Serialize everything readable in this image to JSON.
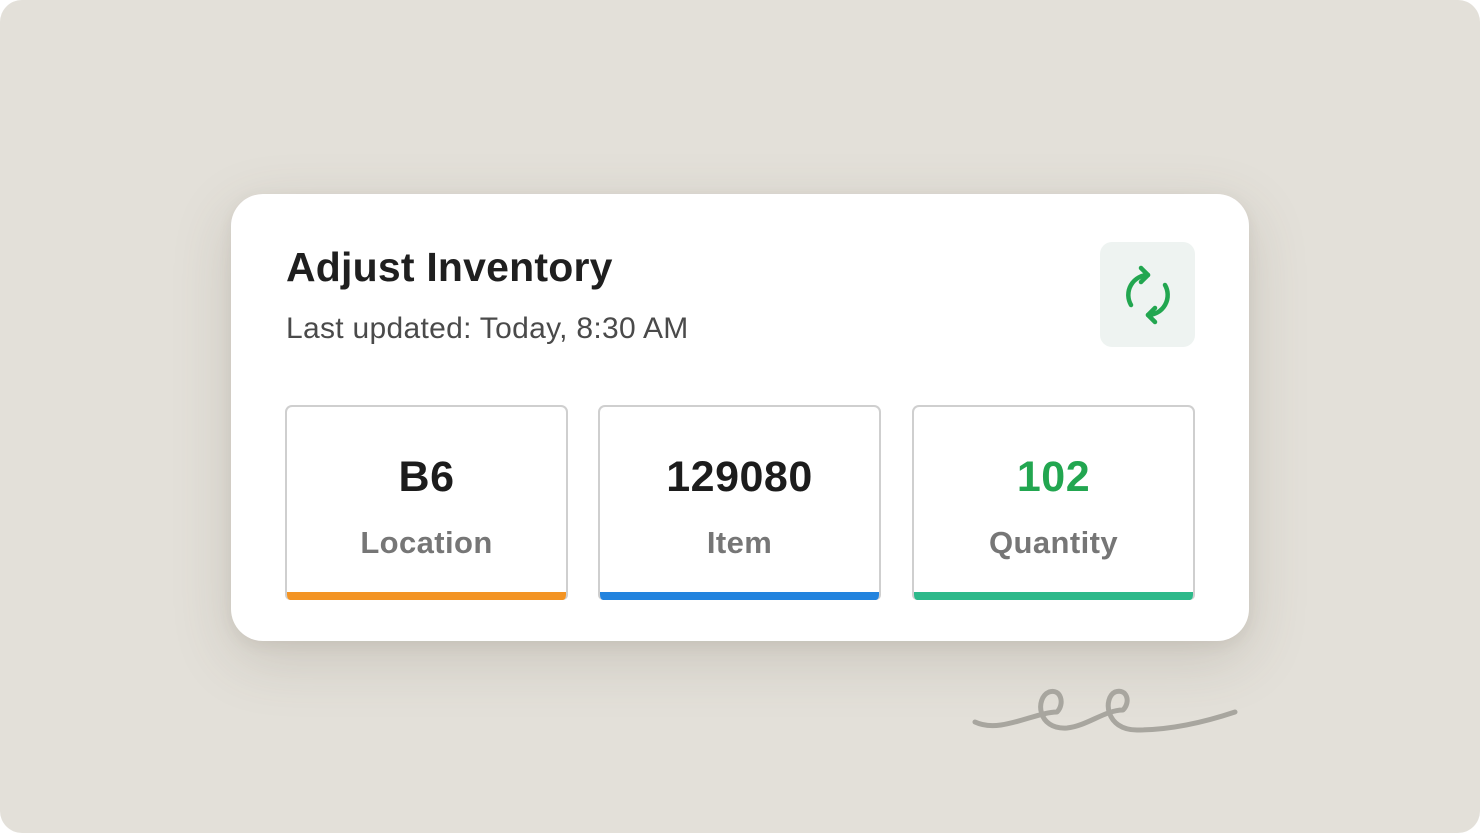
{
  "card": {
    "title": "Adjust Inventory",
    "subtitle": "Last updated: Today, 8:30 AM",
    "refresh_icon": "refresh-icon"
  },
  "stats": [
    {
      "value": "B6",
      "label": "Location",
      "value_color": "#1c1c1c",
      "accent_color": "#f39424"
    },
    {
      "value": "129080",
      "label": "Item",
      "value_color": "#1c1c1c",
      "accent_color": "#2283de"
    },
    {
      "value": "102",
      "label": "Quantity",
      "value_color": "#22a650",
      "accent_color": "#2db98a"
    }
  ],
  "colors": {
    "background": "#e3e0d9",
    "card": "#ffffff",
    "refresh_icon": "#22a650",
    "refresh_button_bg": "#eef3f1",
    "squiggle": "#a8a69f"
  }
}
